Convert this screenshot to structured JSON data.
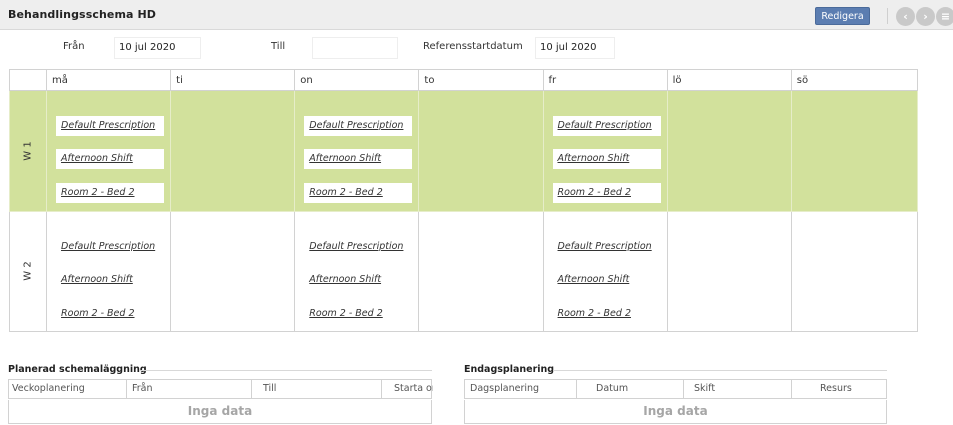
{
  "header": {
    "title": "Behandlingsschema HD",
    "edit_label": "Redigera",
    "nav": [
      "‹",
      "›",
      "≡"
    ]
  },
  "filters": {
    "from_label": "Från",
    "from_value": "10 jul 2020",
    "to_label": "Till",
    "to_value": "",
    "ref_label": "Referensstartdatum",
    "ref_value": "10 jul 2020"
  },
  "schedule": {
    "days": [
      "må",
      "ti",
      "on",
      "to",
      "fr",
      "lö",
      "sö"
    ],
    "weeks": [
      {
        "label": "W 1",
        "days": [
          [
            "Default Prescription",
            "Afternoon Shift",
            "Room 2 - Bed 2"
          ],
          [],
          [
            "Default Prescription",
            "Afternoon Shift",
            "Room 2 - Bed 2"
          ],
          [],
          [
            "Default Prescription",
            "Afternoon Shift",
            "Room 2 - Bed 2"
          ],
          [],
          []
        ]
      },
      {
        "label": "W 2",
        "days": [
          [
            "Default Prescription",
            "Afternoon Shift",
            "Room 2 - Bed 2"
          ],
          [],
          [
            "Default Prescription",
            "Afternoon Shift",
            "Room 2 - Bed 2"
          ],
          [],
          [
            "Default Prescription",
            "Afternoon Shift",
            "Room 2 - Bed 2"
          ],
          [],
          []
        ]
      }
    ]
  },
  "planned": {
    "title": "Planerad schemaläggning",
    "columns": [
      "Veckoplanering",
      "Från",
      "Till",
      "Starta om"
    ],
    "empty": "Inga data"
  },
  "daily": {
    "title": "Endagsplanering",
    "columns": [
      "Dagsplanering",
      "Datum",
      "Skift",
      "Resurs"
    ],
    "empty": "Inga data"
  }
}
